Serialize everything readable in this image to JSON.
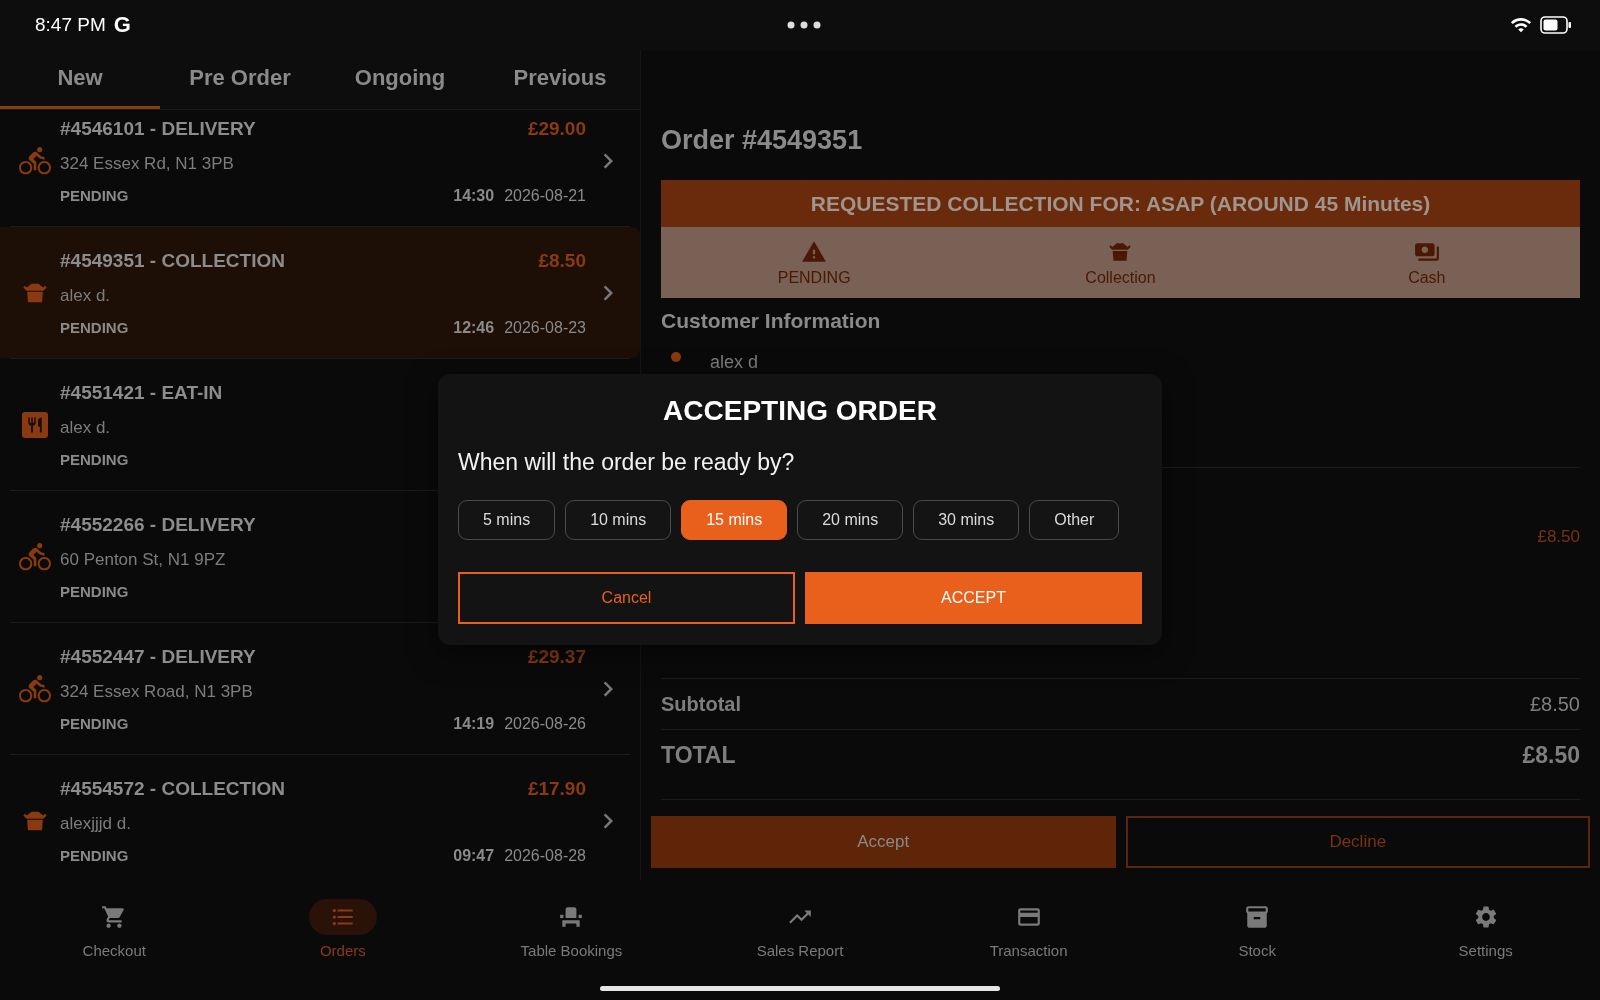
{
  "status_bar": {
    "time": "8:47 PM",
    "notification_icon": "G"
  },
  "tabs": [
    {
      "label": "New",
      "selected": true
    },
    {
      "label": "Pre Order",
      "selected": false
    },
    {
      "label": "Ongoing",
      "selected": false
    },
    {
      "label": "Previous",
      "selected": false
    }
  ],
  "orders": [
    {
      "kind": "delivery",
      "title": "#4546101 - DELIVERY",
      "detail": "324 Essex Rd, N1 3PB",
      "status": "PENDING",
      "price": "£29.00",
      "time": "14:30",
      "date": "2026-08-21",
      "selected": false
    },
    {
      "kind": "collection",
      "title": "#4549351 - COLLECTION",
      "detail": "alex d.",
      "status": "PENDING",
      "price": "£8.50",
      "time": "12:46",
      "date": "2026-08-23",
      "selected": true
    },
    {
      "kind": "eat-in",
      "title": "#4551421 - EAT-IN",
      "detail": "alex d.",
      "status": "PENDING",
      "selected": false
    },
    {
      "kind": "delivery",
      "title": "#4552266 - DELIVERY",
      "detail": "60 Penton St, N1 9PZ",
      "status": "PENDING",
      "selected": false
    },
    {
      "kind": "delivery",
      "title": "#4552447 - DELIVERY",
      "detail": "324 Essex Road, N1 3PB",
      "status": "PENDING",
      "price": "£29.37",
      "time": "14:19",
      "date": "2026-08-26",
      "selected": false
    },
    {
      "kind": "collection",
      "title": "#4554572 - COLLECTION",
      "detail": "alexjjjd d.",
      "status": "PENDING",
      "price": "£17.90",
      "time": "09:47",
      "date": "2026-08-28",
      "selected": false
    }
  ],
  "order_detail": {
    "title": "Order #4549351",
    "banner": "REQUESTED COLLECTION FOR: ASAP (AROUND 45 Minutes)",
    "badges": [
      {
        "kind": "status",
        "label": "PENDING"
      },
      {
        "kind": "collection",
        "label": "Collection"
      },
      {
        "kind": "cash",
        "label": "Cash"
      }
    ],
    "customer_heading": "Customer Information",
    "customer_name": "alex d",
    "items": [
      {
        "price": "£8.50"
      }
    ],
    "subtotal_label": "Subtotal",
    "subtotal": "£8.50",
    "total_label": "TOTAL",
    "total": "£8.50",
    "actions": [
      {
        "kind": "primary",
        "label": "Accept"
      },
      {
        "kind": "outline",
        "label": "Decline"
      }
    ]
  },
  "dialog": {
    "title": "ACCEPTING ORDER",
    "question": "When will the order be ready by?",
    "options": [
      {
        "label": "5 mins",
        "selected": false
      },
      {
        "label": "10 mins",
        "selected": false
      },
      {
        "label": "15 mins",
        "selected": true
      },
      {
        "label": "20 mins",
        "selected": false
      },
      {
        "label": "30 mins",
        "selected": false
      },
      {
        "label": "Other",
        "selected": false
      }
    ],
    "buttons": [
      {
        "kind": "outline",
        "label": "Cancel"
      },
      {
        "kind": "primary",
        "label": "ACCEPT"
      }
    ]
  },
  "nav": [
    {
      "kind": "cart",
      "label": "Checkout",
      "selected": false
    },
    {
      "kind": "list",
      "label": "Orders",
      "selected": true
    },
    {
      "kind": "seat",
      "label": "Table Bookings",
      "selected": false
    },
    {
      "kind": "trend",
      "label": "Sales Report",
      "selected": false
    },
    {
      "kind": "card",
      "label": "Transaction",
      "selected": false
    },
    {
      "kind": "archive",
      "label": "Stock",
      "selected": false
    },
    {
      "kind": "gear",
      "label": "Settings",
      "selected": false
    }
  ]
}
